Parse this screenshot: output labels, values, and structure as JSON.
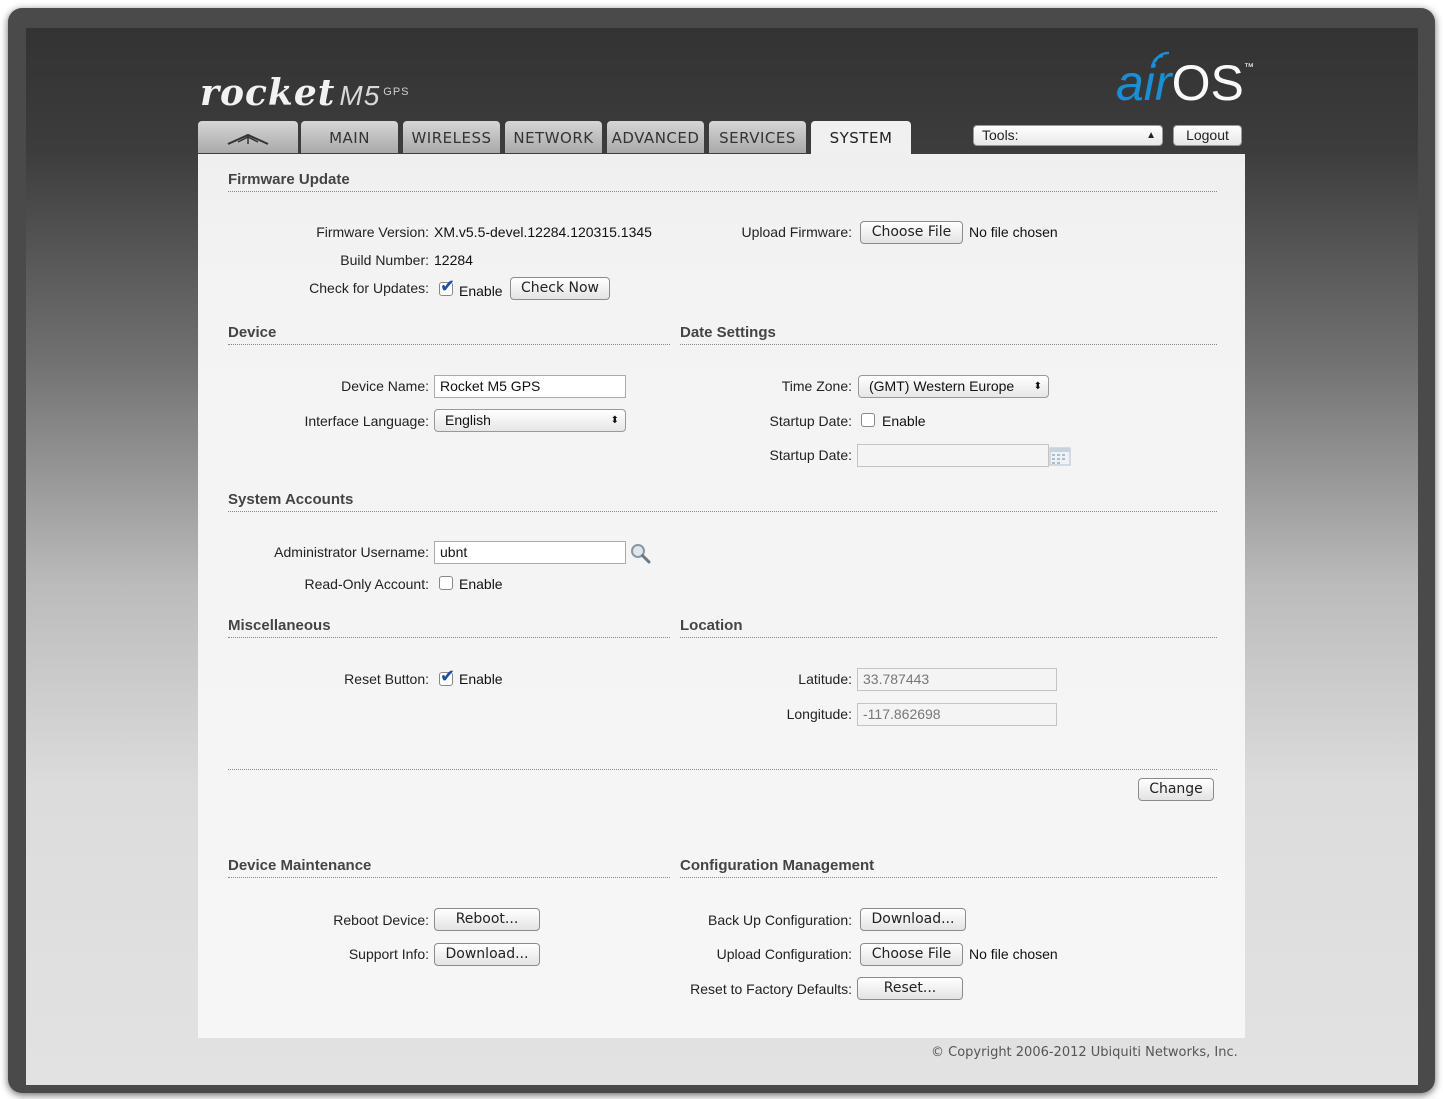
{
  "header": {
    "brand": "rocket",
    "model": "M5",
    "model_sub": "GPS",
    "logo_air": "air",
    "logo_os": "OS",
    "logo_tm": "™"
  },
  "tabs": [
    {
      "label": "",
      "icon": "ubiquiti-logo-icon"
    },
    {
      "label": "MAIN"
    },
    {
      "label": "WIRELESS"
    },
    {
      "label": "NETWORK"
    },
    {
      "label": "ADVANCED"
    },
    {
      "label": "SERVICES"
    },
    {
      "label": "SYSTEM",
      "active": true
    }
  ],
  "tools": {
    "selected": "Tools:"
  },
  "logout_label": "Logout",
  "firmware": {
    "title": "Firmware Update",
    "version_label": "Firmware Version:",
    "version_value": "XM.v5.5-devel.12284.120315.1345",
    "build_label": "Build Number:",
    "build_value": "12284",
    "check_label": "Check for Updates:",
    "check_enable": "Enable",
    "check_enabled": true,
    "check_now": "Check Now",
    "upload_label": "Upload Firmware:",
    "choose_file": "Choose File",
    "no_file": "No file chosen"
  },
  "device": {
    "title": "Device",
    "name_label": "Device Name:",
    "name_value": "Rocket M5 GPS",
    "lang_label": "Interface Language:",
    "lang_value": "English"
  },
  "date": {
    "title": "Date Settings",
    "tz_label": "Time Zone:",
    "tz_value": "(GMT) Western Europе",
    "startup_label": "Startup Date:",
    "startup_enable": "Enable",
    "startup_enabled": false,
    "startup_date_label": "Startup Date:",
    "startup_date_value": ""
  },
  "accounts": {
    "title": "System Accounts",
    "admin_label": "Administrator Username:",
    "admin_value": "ubnt",
    "ro_label": "Read-Only Account:",
    "ro_enable": "Enable",
    "ro_enabled": false
  },
  "misc": {
    "title": "Miscellaneous",
    "reset_label": "Reset Button:",
    "reset_enable": "Enable",
    "reset_enabled": true
  },
  "location": {
    "title": "Location",
    "lat_label": "Latitude:",
    "lat_value": "33.787443",
    "lon_label": "Longitude:",
    "lon_value": "-117.862698"
  },
  "change_label": "Change",
  "maintenance": {
    "title": "Device Maintenance",
    "reboot_label": "Reboot Device:",
    "reboot_btn": "Reboot...",
    "support_label": "Support Info:",
    "support_btn": "Download..."
  },
  "config": {
    "title": "Configuration Management",
    "backup_label": "Back Up Configuration:",
    "backup_btn": "Download...",
    "upload_label": "Upload Configuration:",
    "choose_file": "Choose File",
    "no_file": "No file chosen",
    "reset_label": "Reset to Factory Defaults:",
    "reset_btn": "Reset..."
  },
  "copyright": "© Copyright 2006-2012 Ubiquiti Networks, Inc."
}
